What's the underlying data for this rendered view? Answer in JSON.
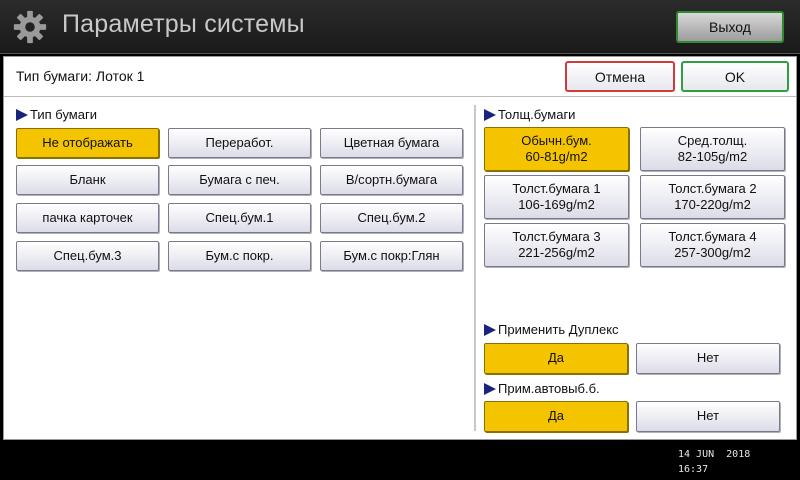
{
  "header": {
    "title": "Параметры системы",
    "exit_label": "Выход"
  },
  "topbar": {
    "label": "Тип бумаги: Лоток 1",
    "cancel_label": "Отмена",
    "ok_label": "OK"
  },
  "paper_type": {
    "label": "Тип бумаги",
    "selected": "Не отображать",
    "options": [
      "Не отображать",
      "Переработ.",
      "Цветная бумага",
      "Бланк",
      "Бумага с печ.",
      "В/сортн.бумага",
      "пачка карточек",
      "Спец.бум.1",
      "Спец.бум.2",
      "Спец.бум.3",
      "Бум.с покр.",
      "Бум.с покр:Глян"
    ]
  },
  "thickness": {
    "label": "Толщ.бумаги",
    "selected": "Обычн.бум. 60-81g/m2",
    "options": [
      {
        "line1": "Обычн.бум.",
        "line2": "60-81g/m2"
      },
      {
        "line1": "Сред.толщ.",
        "line2": "82-105g/m2"
      },
      {
        "line1": "Толст.бумага 1",
        "line2": "106-169g/m2"
      },
      {
        "line1": "Толст.бумага 2",
        "line2": "170-220g/m2"
      },
      {
        "line1": "Толст.бумага 3",
        "line2": "221-256g/m2"
      },
      {
        "line1": "Толст.бумага 4",
        "line2": "257-300g/m2"
      }
    ]
  },
  "duplex": {
    "label": "Применить Дуплекс",
    "yes": "Да",
    "no": "Нет",
    "selected": "Да"
  },
  "auto_select": {
    "label": "Прим.автовыб.б.",
    "yes": "Да",
    "no": "Нет",
    "selected": "Да"
  },
  "footer": {
    "date": "14 JUN  2018",
    "time": "16:37"
  },
  "colors": {
    "selected": "#f5c400",
    "ok_border": "#2ea043",
    "cancel_border": "#d23b3b",
    "arrow": "#1a237e"
  }
}
